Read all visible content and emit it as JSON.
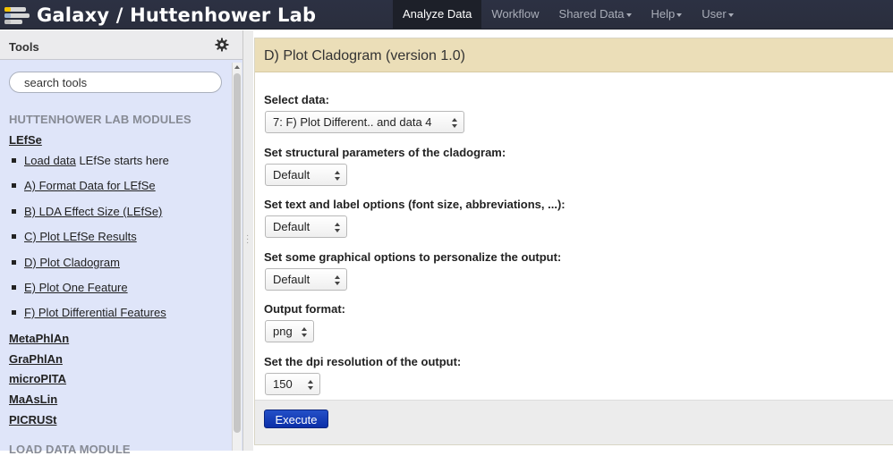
{
  "masthead": {
    "title": "Galaxy / Huttenhower Lab",
    "nav": [
      {
        "label": "Analyze Data",
        "active": true,
        "dropdown": false
      },
      {
        "label": "Workflow",
        "active": false,
        "dropdown": false
      },
      {
        "label": "Shared Data",
        "active": false,
        "dropdown": true
      },
      {
        "label": "Help",
        "active": false,
        "dropdown": true
      },
      {
        "label": "User",
        "active": false,
        "dropdown": true
      }
    ]
  },
  "tools": {
    "title": "Tools",
    "search_placeholder": "search tools",
    "section1": "HUTTENHOWER LAB MODULES",
    "lefse_group": "LEfSe",
    "items": [
      {
        "link": "Load data",
        "suffix": " LEfSe starts here"
      },
      {
        "link": "A) Format Data for LEfSe",
        "suffix": ""
      },
      {
        "link": "B) LDA Effect Size (LEfSe)",
        "suffix": ""
      },
      {
        "link": "C) Plot LEfSe Results",
        "suffix": ""
      },
      {
        "link": "D) Plot Cladogram",
        "suffix": ""
      },
      {
        "link": "E) Plot One Feature",
        "suffix": ""
      },
      {
        "link": "F) Plot Differential Features",
        "suffix": ""
      }
    ],
    "groups": [
      "MetaPhlAn",
      "GraPhlAn",
      "microPITA",
      "MaAsLin",
      "PICRUSt"
    ],
    "section2": "LOAD DATA MODULE"
  },
  "form": {
    "title": "D) Plot Cladogram (version 1.0)",
    "fields": [
      {
        "label": "Select data:",
        "value": "7: F) Plot Different.. and data 4"
      },
      {
        "label": "Set structural parameters of the cladogram:",
        "value": "Default"
      },
      {
        "label": "Set text and label options (font size, abbreviations, ...):",
        "value": "Default"
      },
      {
        "label": "Set some graphical options to personalize the output:",
        "value": "Default"
      },
      {
        "label": "Output format:",
        "value": "png"
      },
      {
        "label": "Set the dpi resolution of the output:",
        "value": "150"
      }
    ],
    "execute_label": "Execute"
  },
  "colors": {
    "masthead_bg": "#2c3143",
    "tool_panel_bg": "#dfe5f9",
    "form_header_bg": "#ebdeb8",
    "execute_bg": "#0b2fa8"
  }
}
